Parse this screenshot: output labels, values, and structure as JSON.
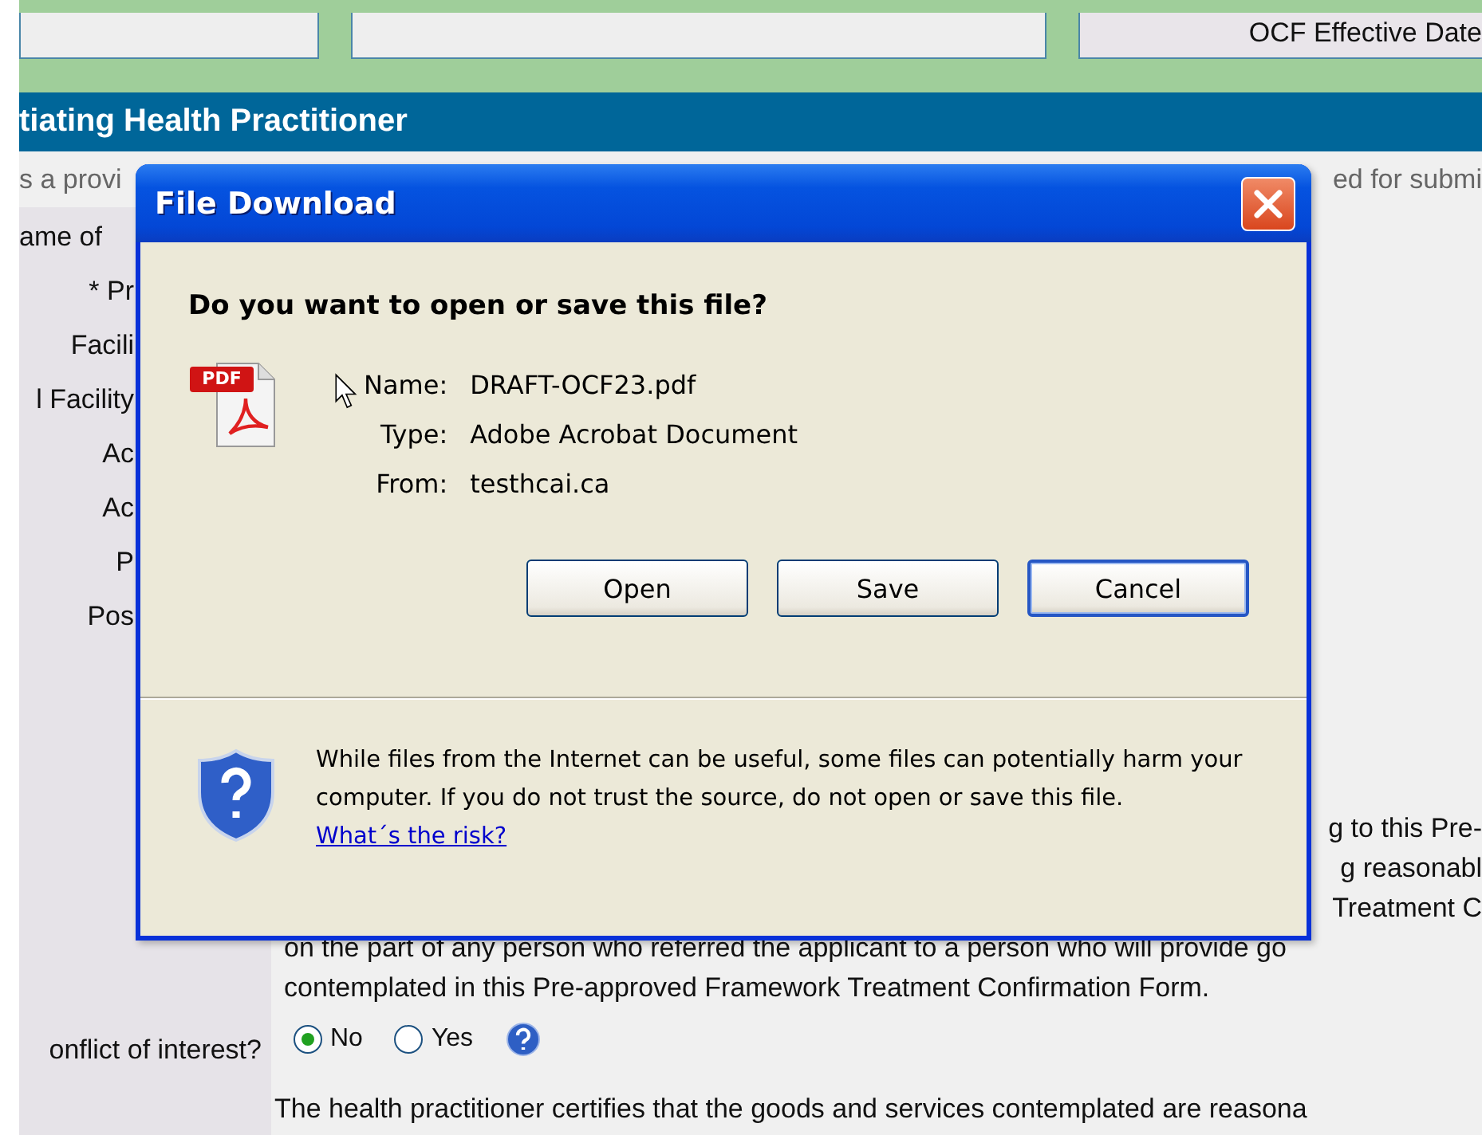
{
  "form": {
    "top_band": {
      "box_text": "OCF Effective Date"
    },
    "section_header": "tiating Health Practitioner",
    "intro": {
      "left": "s a provi",
      "right": "ed for submi"
    },
    "labels": [
      "ame of",
      "* Pr",
      "Facili",
      "l Facility",
      "Ac",
      "Ac",
      "P",
      "Pos"
    ],
    "fragments": [
      "g to this Pre-",
      "g reasonabl",
      "Treatment C"
    ],
    "lines": [
      "on the part of any person who referred the applicant to a person who will provide go",
      "contemplated in this Pre-approved Framework Treatment Confirmation Form."
    ],
    "conflict": {
      "label": "onflict of interest?",
      "options": [
        {
          "label": "No",
          "selected": true
        },
        {
          "label": "Yes",
          "selected": false
        }
      ]
    },
    "certify": "The health practitioner certifies that the goods and services contemplated are reasona"
  },
  "dialog": {
    "title": "File Download",
    "icon_label": "PDF",
    "question": "Do you want to open or save this file?",
    "fields": [
      {
        "label": "Name:",
        "value": "DRAFT-OCF23.pdf"
      },
      {
        "label": "Type:",
        "value": "Adobe Acrobat Document"
      },
      {
        "label": "From:",
        "value": "testhcai.ca"
      }
    ],
    "buttons": [
      {
        "label": "Open",
        "default": false
      },
      {
        "label": "Save",
        "default": false
      },
      {
        "label": "Cancel",
        "default": true
      }
    ],
    "warning": "While files from the Internet can be useful, some files can potentially harm your computer. If you do not trust the source, do not open or save this file.",
    "link": "What´s the risk?"
  }
}
